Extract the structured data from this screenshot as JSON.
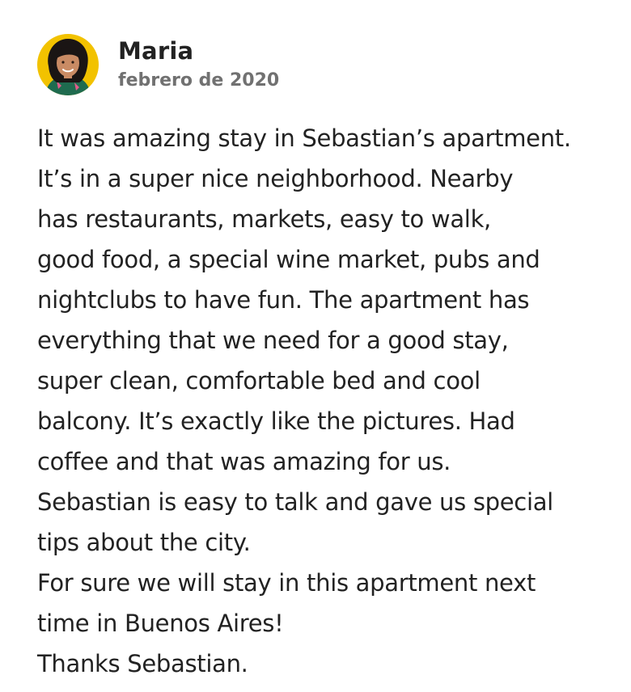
{
  "review": {
    "author": {
      "name": "Maria",
      "avatar_icon": "user-photo-avatar"
    },
    "date": "febrero de 2020",
    "text_lines": [
      "It was amazing stay in Sebastian’s apartment.",
      "It’s in a super nice neighborhood. Nearby",
      "has restaurants, markets, easy to walk,",
      "good food, a special wine market, pubs and",
      "nightclubs to have fun. The apartment has",
      "everything that we need for a good stay,",
      "super clean, comfortable bed and cool",
      "balcony. It’s exactly like the pictures. Had",
      "coffee and that was amazing for us.",
      "Sebastian is easy to talk and gave us special",
      "tips about the city.",
      "For sure we will stay in this apartment next",
      "time in Buenos Aires!",
      "Thanks Sebastian."
    ]
  },
  "colors": {
    "text_primary": "#222222",
    "text_secondary": "#717171",
    "background": "#ffffff",
    "avatar_background": "#f2c200"
  }
}
